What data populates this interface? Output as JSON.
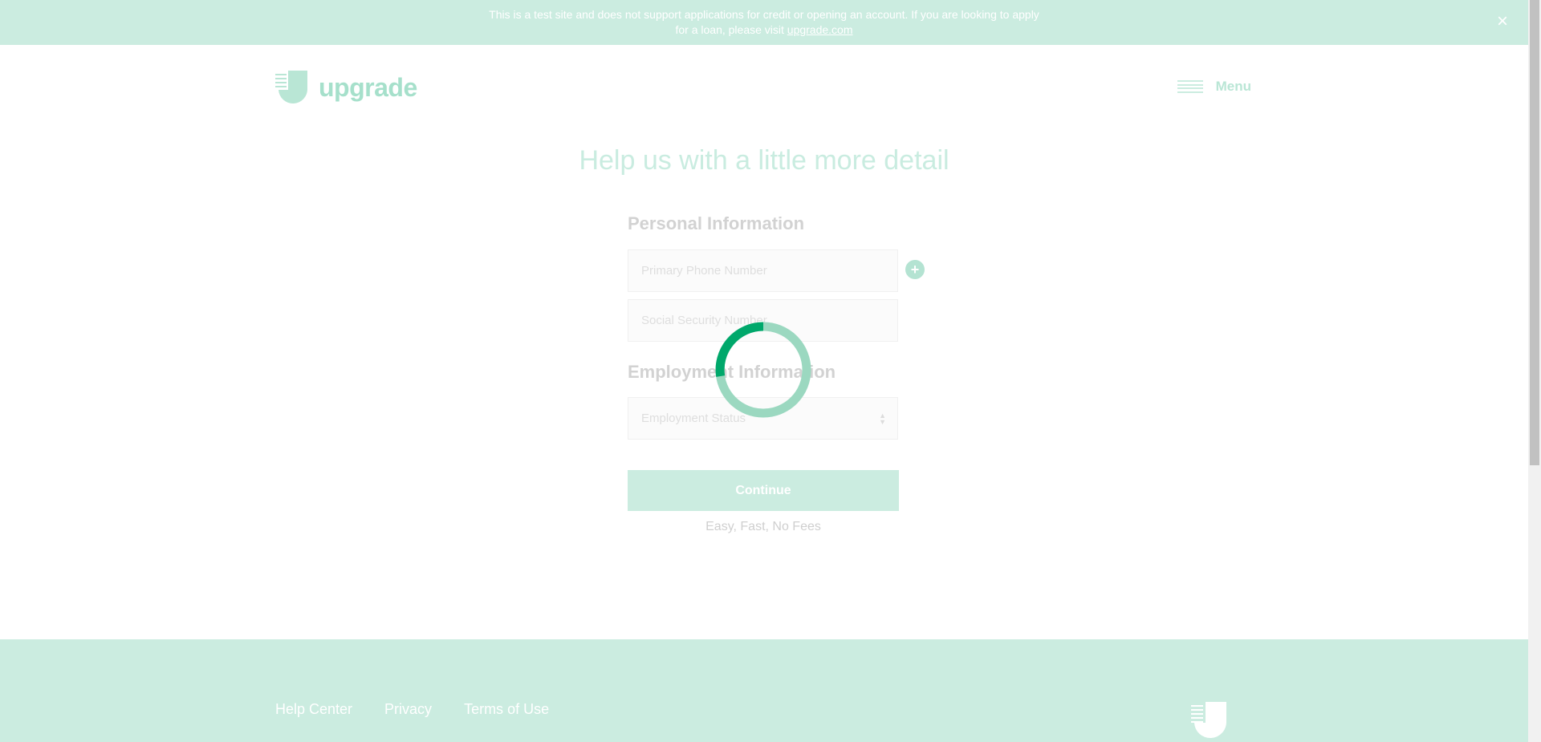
{
  "banner": {
    "text": "This is a test site and does not support applications for credit or opening an account. If you are looking to apply for a loan, please visit",
    "link_text": "upgrade.com",
    "close_icon": "close-icon"
  },
  "header": {
    "logo_text": "upgrade",
    "menu_label": "Menu",
    "menu_icon": "hamburger-icon"
  },
  "main": {
    "title": "Help us with a little more detail",
    "personal_section_title": "Personal Information",
    "phone_placeholder": "Primary Phone Number",
    "ssn_placeholder": "Social Security Number",
    "add_phone_icon": "plus-circle-icon",
    "employment_section_title": "Employment Information",
    "employment_status_placeholder": "Employment Status",
    "continue_label": "Continue",
    "tagline": "Easy, Fast, No Fees"
  },
  "loading": {
    "icon": "loading-spinner-icon",
    "accent_color": "#00a86b",
    "track_color": "#9bd8c0"
  },
  "footer": {
    "links": [
      "Help Center",
      "Privacy",
      "Terms of Use"
    ],
    "logo_icon": "upgrade-logo-icon"
  },
  "colors": {
    "banner_bg": "#cbece0",
    "brand_light": "#a6e0cb"
  }
}
